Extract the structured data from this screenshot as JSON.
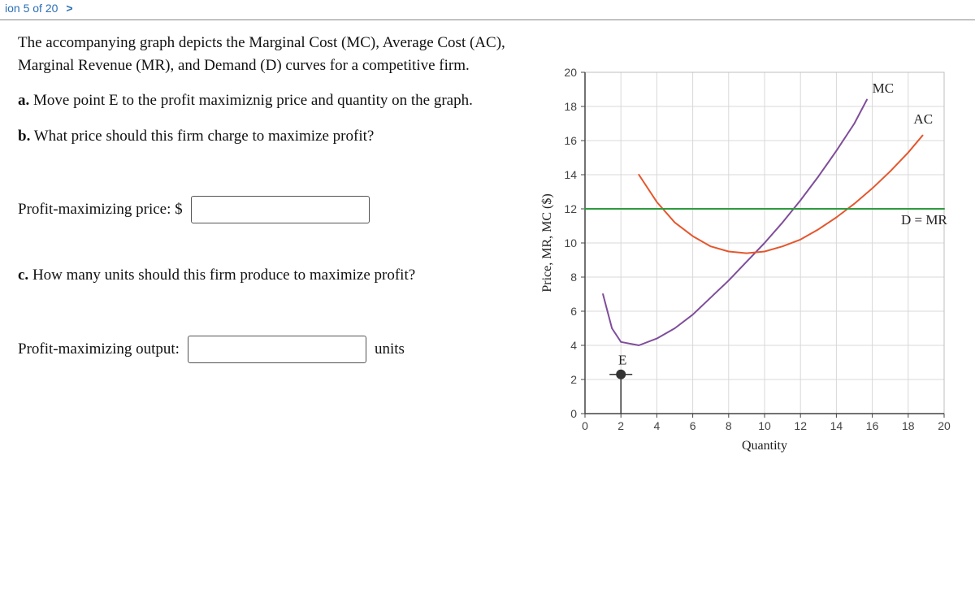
{
  "header": {
    "progress": "ion 5 of 20",
    "chevron": ">"
  },
  "intro": "The accompanying graph depicts the Marginal Cost (MC), Average Cost (AC), Marginal Revenue (MR), and Demand (D) curves for a competitive firm.",
  "part_a_label": "a.",
  "part_a_text": " Move point E to the profit maximiznig price and quantity on the graph.",
  "part_b_label": "b.",
  "part_b_text": " What price should this firm charge to maximize profit?",
  "price_label": "Profit-maximizing price: $",
  "part_c_label": "c.",
  "part_c_text": " How many units should this firm produce to maximize profit?",
  "output_label": "Profit-maximizing output:",
  "units_label": "units",
  "chart_data": {
    "type": "line",
    "xlabel": "Quantity",
    "ylabel": "Price, MR, MC ($)",
    "xlim": [
      0,
      20
    ],
    "ylim": [
      0,
      20
    ],
    "xticks": [
      0,
      2,
      4,
      6,
      8,
      10,
      12,
      14,
      16,
      18,
      20
    ],
    "yticks": [
      0,
      2,
      4,
      6,
      8,
      10,
      12,
      14,
      16,
      18,
      20
    ],
    "series": [
      {
        "name": "MC",
        "color": "#7f4d9b",
        "points": [
          [
            1,
            7
          ],
          [
            1.5,
            5
          ],
          [
            2,
            4.2
          ],
          [
            3,
            4
          ],
          [
            4,
            4.4
          ],
          [
            5,
            5
          ],
          [
            6,
            5.8
          ],
          [
            7,
            6.8
          ],
          [
            8,
            7.8
          ],
          [
            9,
            8.9
          ],
          [
            10,
            10
          ],
          [
            11,
            11.2
          ],
          [
            12,
            12.5
          ],
          [
            13,
            13.9
          ],
          [
            14,
            15.4
          ],
          [
            15,
            17
          ],
          [
            15.7,
            18.4
          ]
        ]
      },
      {
        "name": "AC",
        "color": "#e4572e",
        "points": [
          [
            3,
            14
          ],
          [
            4,
            12.4
          ],
          [
            5,
            11.2
          ],
          [
            6,
            10.4
          ],
          [
            7,
            9.8
          ],
          [
            8,
            9.5
          ],
          [
            9,
            9.4
          ],
          [
            10,
            9.5
          ],
          [
            11,
            9.8
          ],
          [
            12,
            10.2
          ],
          [
            13,
            10.8
          ],
          [
            14,
            11.5
          ],
          [
            15,
            12.3
          ],
          [
            16,
            13.2
          ],
          [
            17,
            14.2
          ],
          [
            18,
            15.3
          ],
          [
            18.8,
            16.3
          ]
        ]
      },
      {
        "name": "D = MR",
        "color": "#2e9b3e",
        "points": [
          [
            0,
            12
          ],
          [
            20,
            12
          ]
        ]
      }
    ],
    "labels": {
      "MC": "MC",
      "AC": "AC",
      "DMR": "D = MR",
      "E": "E"
    },
    "point_E": {
      "x": 2,
      "y": 2.3
    }
  }
}
